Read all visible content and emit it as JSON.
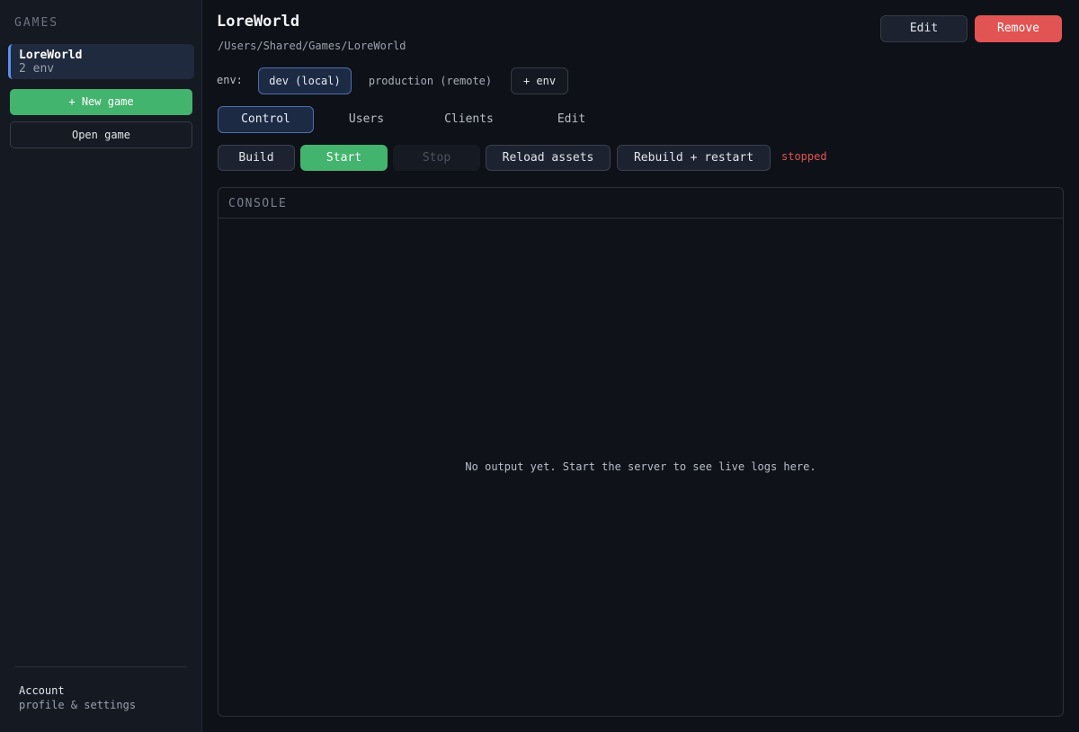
{
  "sidebar": {
    "heading": "GAMES",
    "games": [
      {
        "name": "LoreWorld",
        "subtitle": "2 env"
      }
    ],
    "new_game_label": "+ New game",
    "open_game_label": "Open game",
    "account": {
      "title": "Account",
      "subtitle": "profile & settings"
    }
  },
  "header": {
    "title": "LoreWorld",
    "path": "/Users/Shared/Games/LoreWorld",
    "edit_label": "Edit",
    "remove_label": "Remove"
  },
  "env": {
    "label": "env:",
    "options": [
      "dev (local)",
      "production (remote)"
    ],
    "selected": "dev (local)",
    "add_label": "+ env"
  },
  "tabs": {
    "items": [
      "Control",
      "Users",
      "Clients",
      "Edit"
    ],
    "active": "Control"
  },
  "controls": {
    "build": "Build",
    "start": "Start",
    "stop": "Stop",
    "reload": "Reload assets",
    "rebuild": "Rebuild + restart",
    "status": "stopped"
  },
  "console": {
    "title": "CONSOLE",
    "empty_message": "No output yet. Start the server to see live logs here."
  },
  "colors": {
    "accent": "#5d8ff0",
    "success": "#43b46e",
    "danger": "#e25454",
    "background": "#0e1117",
    "sidebar": "#151922"
  }
}
